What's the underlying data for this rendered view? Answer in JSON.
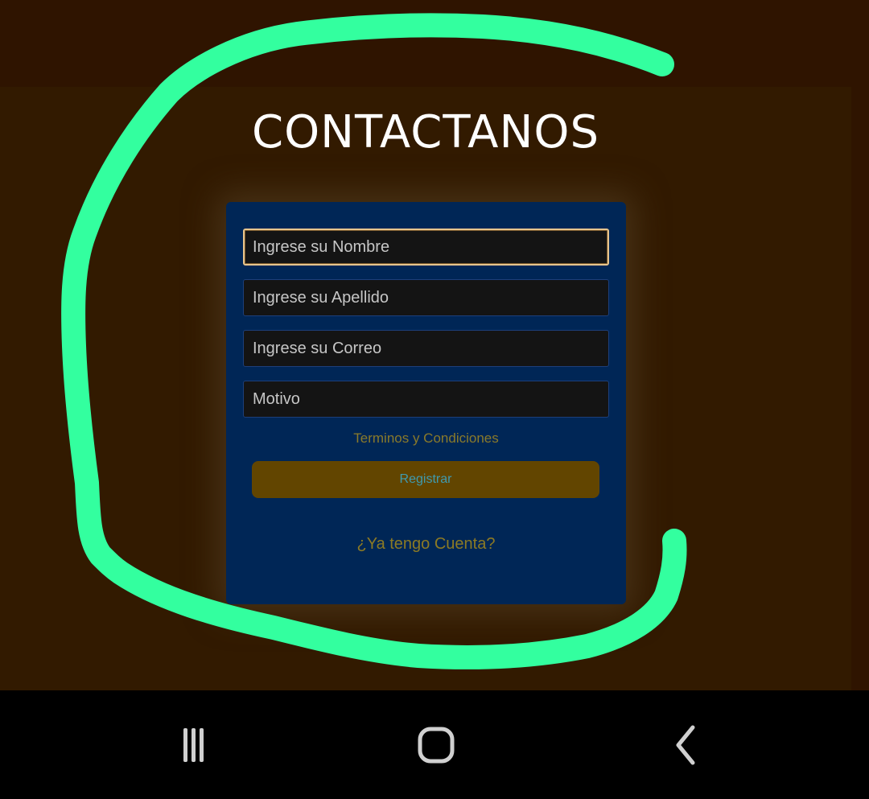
{
  "page": {
    "title": "CONTACTANOS"
  },
  "form": {
    "nombre_placeholder": "Ingrese su Nombre",
    "apellido_placeholder": "Ingrese su Apellido",
    "correo_placeholder": "Ingrese su Correo",
    "motivo_placeholder": "Motivo",
    "terms_label": "Terminos y Condiciones",
    "register_label": "Registrar",
    "account_label": "¿Ya tengo Cuenta?"
  },
  "annotation": {
    "color": "#33ff9f"
  },
  "nav": {
    "recents_icon": "recent-apps-icon",
    "home_icon": "home-icon",
    "back_icon": "back-icon"
  },
  "colors": {
    "background": "#321a00",
    "card": "#002656",
    "button": "#624500",
    "link": "#8a7a2a"
  }
}
